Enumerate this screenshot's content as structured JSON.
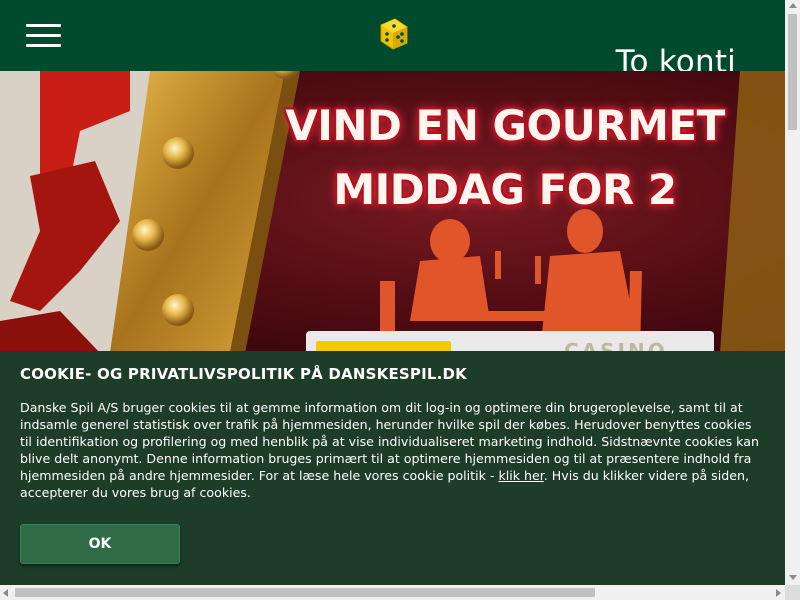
{
  "header": {
    "menu_icon": "hamburger-menu-icon",
    "logo_icon": "dice-logo-icon",
    "account_link": "To konti",
    "colors": {
      "header_bg": "#004b2d",
      "text": "#ffffff"
    }
  },
  "hero": {
    "promo_line1": "VIND EN GOURMET",
    "promo_line2": "MIDDAG FOR 2",
    "card_brand": "CASINO",
    "colors": {
      "background": "#4e0b12",
      "accent": "#b4101e",
      "gold": "#d4a02a",
      "yellow_bar": "#f6c800"
    }
  },
  "cookie_banner": {
    "title": "COOKIE- OG PRIVATLIVSPOLITIK PÅ DANSKESPIL.DK",
    "body_before_link": "Danske Spil A/S bruger cookies til at gemme information om dit log-in og optimere din brugeroplevelse, samt til at indsamle generel statistisk over trafik på hjemmesiden, herunder hvilke spil der købes. Herudover benyttes cookies til identifikation og profilering og med henblik på at vise individualiseret marketing indhold. Sidstnævnte cookies kan blive delt anonymt. Denne information bruges primært til at optimere hjemmesiden og til at præsentere indhold fra hjemmesiden på andre hjemmesider. For at læse hele vores cookie politik - ",
    "link_text": "klik her",
    "body_after_link": ". Hvis du klikker videre på siden, accepterer du vores brug af cookies.",
    "ok_button": "OK",
    "colors": {
      "background": "#1d3d29",
      "button": "#2e6b46"
    }
  }
}
